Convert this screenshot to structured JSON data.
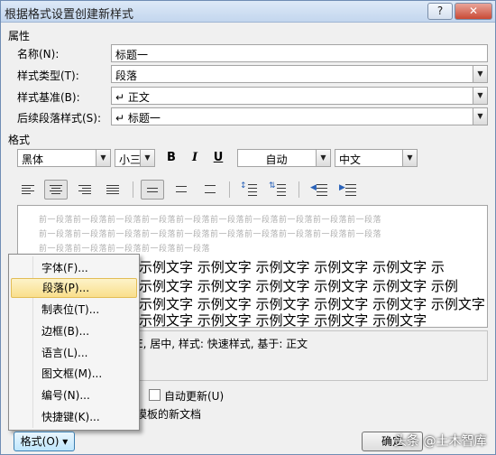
{
  "window": {
    "title": "根据格式设置创建新样式",
    "help_glyph": "?",
    "close_glyph": "✕"
  },
  "properties": {
    "section_label": "属性",
    "name_label": "名称(N):",
    "name_value": "标题一",
    "type_label": "样式类型(T):",
    "type_value": "段落",
    "based_label": "样式基准(B):",
    "based_value": "↵ 正文",
    "following_label": "后续段落样式(S):",
    "following_value": "↵ 标题一"
  },
  "format": {
    "section_label": "格式",
    "font": "黑体",
    "size": "小三",
    "bold": "B",
    "italic": "I",
    "underline": "U",
    "color": "自动",
    "lang": "中文"
  },
  "preview": {
    "prev_paragraph": [
      "前一段落前一段落前一段落前一段落前一段落前一段落前一段落前一段落前一段落前一段落",
      "前一段落前一段落前一段落前一段落前一段落前一段落前一段落前一段落前一段落前一段落",
      "前一段落前一段落前一段落前一段落前一段落"
    ],
    "sample_lines": [
      "示例文字 示例文字 示例文字 示例文字 示例文字 示",
      "示例文字 示例文字 示例文字 示例文字 示例文字 示例",
      "示例文字 示例文字 示例文字 示例文字 示例文字 示例文字",
      "示例文字 示例文字 示例文字 示例文字 示例文字"
    ]
  },
  "description": "E, 居中, 样式: 快速样式, 基于: 正文",
  "auto_update_label": "自动更新(U)",
  "template_label": "模板的新文档",
  "menu": {
    "items": [
      "字体(F)...",
      "段落(P)...",
      "制表位(T)...",
      "边框(B)...",
      "语言(L)...",
      "图文框(M)...",
      "编号(N)...",
      "快捷键(K)..."
    ],
    "highlighted_index": 1
  },
  "buttons": {
    "format": "格式(O) ▾",
    "ok": "确定"
  },
  "watermark": "头条 @土木智库",
  "colors": {
    "title_bar": "#c3d6ee",
    "menu_highlight": "#f9df8b",
    "close_button": "#c94a35"
  }
}
